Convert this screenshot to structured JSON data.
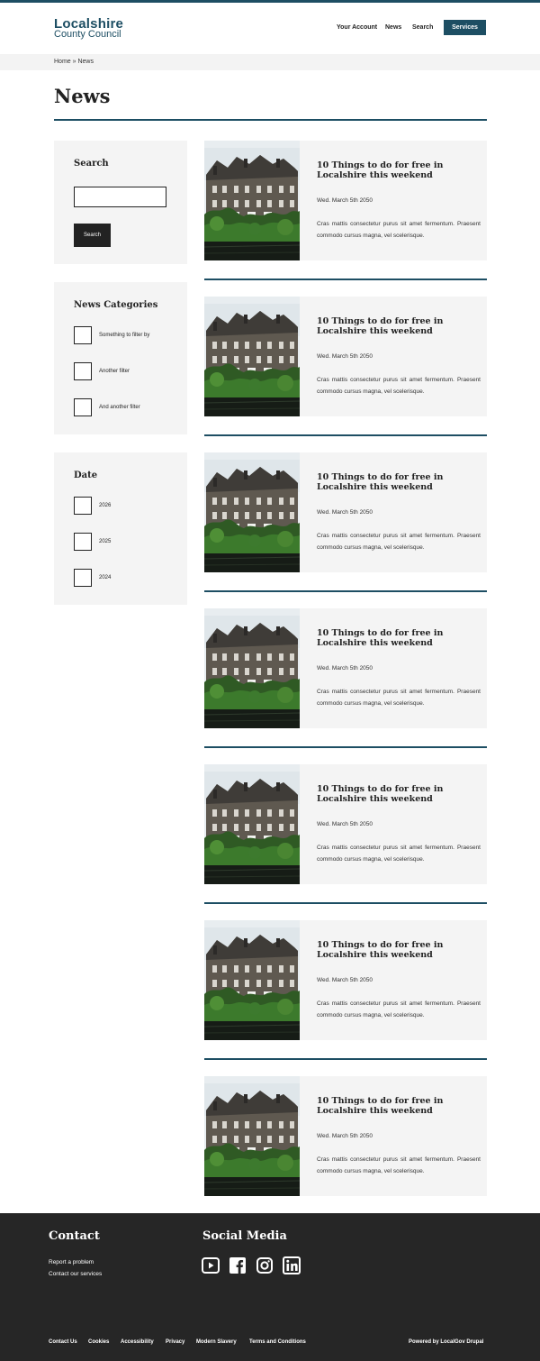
{
  "header": {
    "logo_line1": "Localshire",
    "logo_line2": "County Council",
    "nav": [
      "Your Account",
      "News",
      "Search"
    ],
    "services": "Services"
  },
  "breadcrumb": "Home » News",
  "page_title": "News",
  "sidebar": {
    "search": {
      "title": "Search",
      "button": "Search",
      "placeholder": ""
    },
    "categories": {
      "title": "News Categories",
      "items": [
        "Something to filter by",
        "Another filter",
        "And another filter"
      ]
    },
    "date": {
      "title": "Date",
      "items": [
        "2026",
        "2025",
        "2024"
      ]
    }
  },
  "articles": [
    {
      "title": "10 Things to do for free in Localshire this weekend",
      "date": "Wed. March 5th 2050",
      "excerpt": "Cras mattis consectetur purus sit amet fermentum. Praesent commodo cursus magna, vel scelerisque."
    },
    {
      "title": "10 Things to do for free in Localshire this weekend",
      "date": "Wed. March 5th 2050",
      "excerpt": "Cras mattis consectetur purus sit amet fermentum. Praesent commodo cursus magna, vel scelerisque."
    },
    {
      "title": "10 Things to do for free in Localshire this weekend",
      "date": "Wed. March 5th 2050",
      "excerpt": "Cras mattis consectetur purus sit amet fermentum. Praesent commodo cursus magna, vel scelerisque."
    },
    {
      "title": "10 Things to do for free in Localshire this weekend",
      "date": "Wed. March 5th 2050",
      "excerpt": "Cras mattis consectetur purus sit amet fermentum. Praesent commodo cursus magna, vel scelerisque."
    },
    {
      "title": "10 Things to do for free in Localshire this weekend",
      "date": "Wed. March 5th 2050",
      "excerpt": "Cras mattis consectetur purus sit amet fermentum. Praesent commodo cursus magna, vel scelerisque."
    },
    {
      "title": "10 Things to do for free in Localshire this weekend",
      "date": "Wed. March 5th 2050",
      "excerpt": "Cras mattis consectetur purus sit amet fermentum. Praesent commodo cursus magna, vel scelerisque."
    },
    {
      "title": "10 Things to do for free in Localshire this weekend",
      "date": "Wed. March 5th 2050",
      "excerpt": "Cras mattis consectetur purus sit amet fermentum. Praesent commodo cursus magna, vel scelerisque."
    }
  ],
  "footer": {
    "contact_title": "Contact",
    "contact_links": [
      "Report a problem",
      "Contact our services"
    ],
    "social_title": "Social Media",
    "social_icons": [
      "youtube-icon",
      "facebook-icon",
      "instagram-icon",
      "linkedin-icon"
    ],
    "bottom_links": [
      "Contact Us",
      "Cookies",
      "Accessibility",
      "Privacy",
      "Modern Slavery",
      "Terms and Conditions"
    ],
    "powered_by": "Powered by LocalGov Drupal"
  },
  "colors": {
    "brand": "#1d4e63",
    "panel": "#f4f4f4",
    "footer": "#262626"
  }
}
